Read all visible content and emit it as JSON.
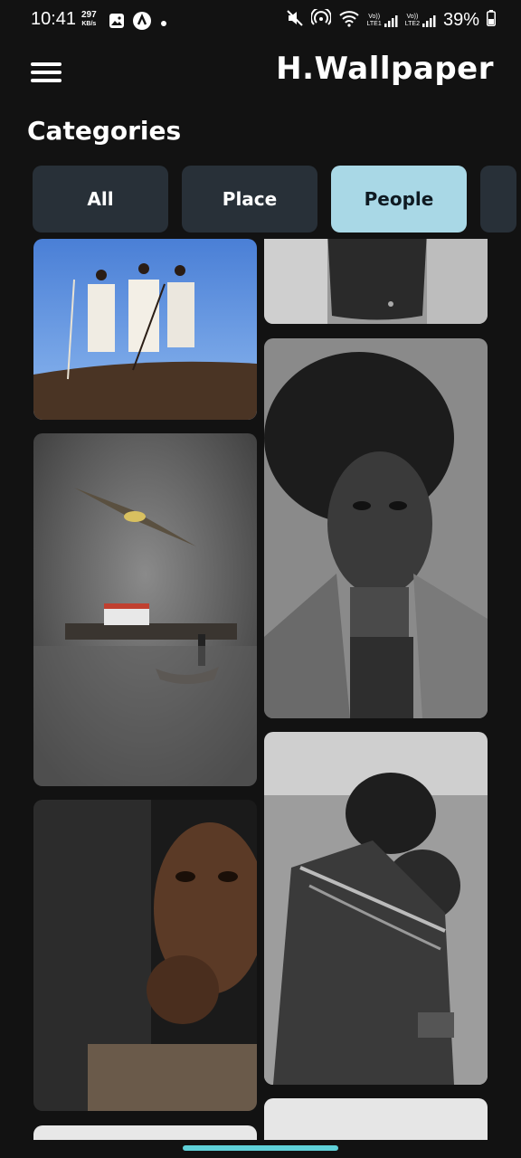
{
  "status_bar": {
    "time": "10:41",
    "speed_value": "297",
    "speed_unit": "KB/s",
    "lte1": "LTE1",
    "lte2": "LTE2",
    "volte": "Vo))",
    "battery": "39%"
  },
  "app_bar": {
    "title": "H.Wallpaper",
    "menu_icon": "hamburger-menu-icon"
  },
  "section": {
    "title": "Categories"
  },
  "chips": [
    {
      "label": "All",
      "selected": false
    },
    {
      "label": "Place",
      "selected": false
    },
    {
      "label": "People",
      "selected": true
    }
  ],
  "colors": {
    "background": "#121212",
    "chip": "#283038",
    "chip_selected": "#a9d8e6",
    "accent": "#5fd0d8"
  }
}
